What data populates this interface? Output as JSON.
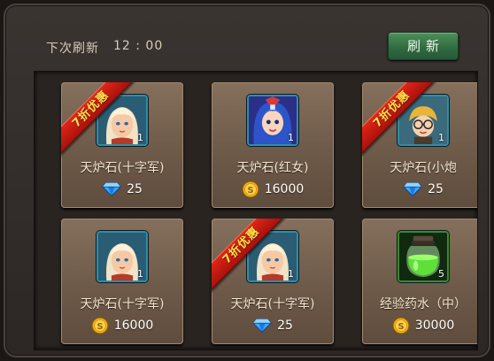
{
  "header": {
    "next_refresh_label": "下次刷新",
    "next_refresh_time": "12 : 00",
    "refresh_button": "刷新"
  },
  "currency_icons": {
    "diamond": "diamond-icon",
    "gold": "gold-coin-icon"
  },
  "colors": {
    "ribbon": "#c81a10",
    "ribbon_text": "#ffe34a",
    "refresh_button": "#3a7a48",
    "card": "#7a6552"
  },
  "items": [
    {
      "name": "天炉石(十字军)",
      "price": "25",
      "currency": "diamond",
      "ribbon": "7折优惠",
      "count": "1",
      "portrait": "crusader-portrait-icon"
    },
    {
      "name": "天炉石(红女)",
      "price": "16000",
      "currency": "gold",
      "ribbon": "",
      "count": "1",
      "portrait": "red-woman-portrait-icon"
    },
    {
      "name": "天炉石(小炮",
      "price": "25",
      "currency": "diamond",
      "ribbon": "7折优惠",
      "count": "1",
      "portrait": "little-cannon-portrait-icon"
    },
    {
      "name": "天炉石(十字军)",
      "price": "16000",
      "currency": "gold",
      "ribbon": "",
      "count": "1",
      "portrait": "crusader-portrait-icon"
    },
    {
      "name": "天炉石(十字军)",
      "price": "25",
      "currency": "diamond",
      "ribbon": "7折优惠",
      "count": "1",
      "portrait": "crusader-portrait-icon"
    },
    {
      "name": "经验药水（中）",
      "price": "30000",
      "currency": "gold",
      "ribbon": "",
      "count": "5",
      "portrait": "exp-potion-icon"
    }
  ]
}
